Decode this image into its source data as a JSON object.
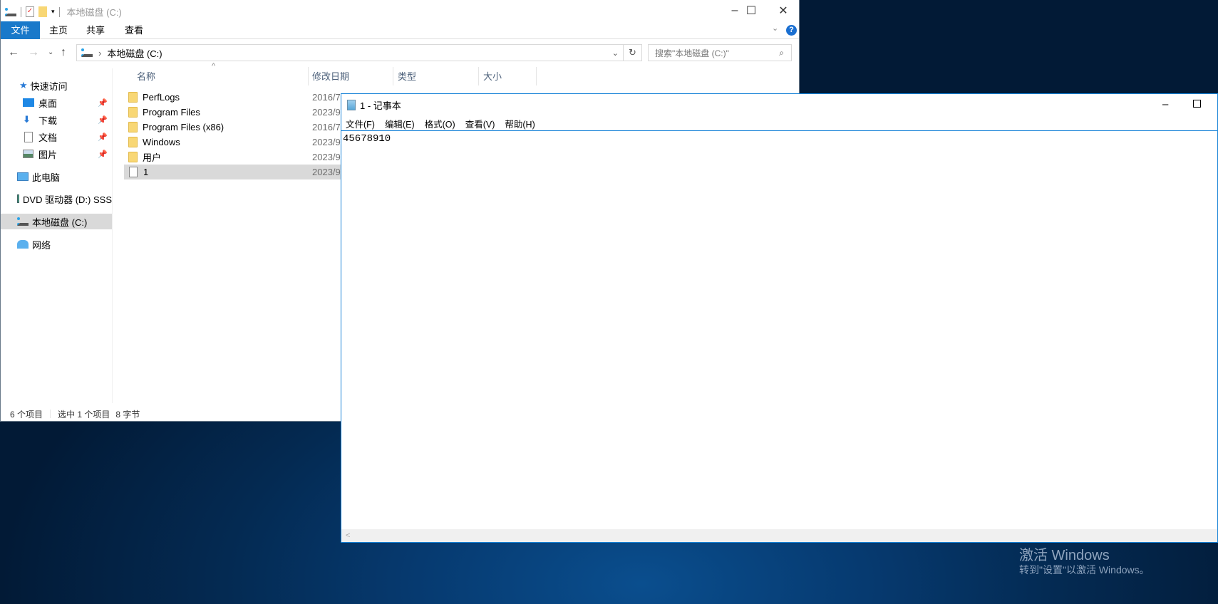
{
  "explorer": {
    "title": "本地磁盘 (C:)",
    "ribbon_tabs": [
      "文件",
      "主页",
      "共享",
      "查看"
    ],
    "address": "本地磁盘 (C:)",
    "search_placeholder": "搜索\"本地磁盘 (C:)\"",
    "sidebar": [
      {
        "label": "快速访问",
        "icon": "star-icon"
      },
      {
        "label": "桌面",
        "icon": "desktop-icon",
        "pinned": true
      },
      {
        "label": "下载",
        "icon": "download-icon",
        "pinned": true
      },
      {
        "label": "文档",
        "icon": "documents-icon",
        "pinned": true
      },
      {
        "label": "图片",
        "icon": "pictures-icon",
        "pinned": true
      },
      {
        "label": "此电脑",
        "icon": "computer-icon"
      },
      {
        "label": "DVD 驱动器 (D:) SSS",
        "icon": "dvd-icon"
      },
      {
        "label": "本地磁盘 (C:)",
        "icon": "drive-icon",
        "selected": true
      },
      {
        "label": "网络",
        "icon": "network-icon"
      }
    ],
    "columns": [
      "名称",
      "修改日期",
      "类型",
      "大小"
    ],
    "files": [
      {
        "name": "PerfLogs",
        "date": "2016/7",
        "type": "folder"
      },
      {
        "name": "Program Files",
        "date": "2023/9",
        "type": "folder"
      },
      {
        "name": "Program Files (x86)",
        "date": "2016/7",
        "type": "folder"
      },
      {
        "name": "Windows",
        "date": "2023/9",
        "type": "folder"
      },
      {
        "name": "用户",
        "date": "2023/9",
        "type": "folder"
      },
      {
        "name": "1",
        "date": "2023/9",
        "type": "file",
        "selected": true
      }
    ],
    "status": {
      "count": "6 个项目",
      "selected": "选中 1 个项目",
      "size": "8 字节"
    }
  },
  "notepad": {
    "title": "1 - 记事本",
    "menu": [
      "文件(F)",
      "编辑(E)",
      "格式(O)",
      "查看(V)",
      "帮助(H)"
    ],
    "content": "45678910"
  },
  "watermark": {
    "line1": "激活 Windows",
    "line2": "转到\"设置\"以激活 Windows。"
  },
  "colors": {
    "accent": "#1979ca",
    "selection": "#d9d9d9"
  }
}
